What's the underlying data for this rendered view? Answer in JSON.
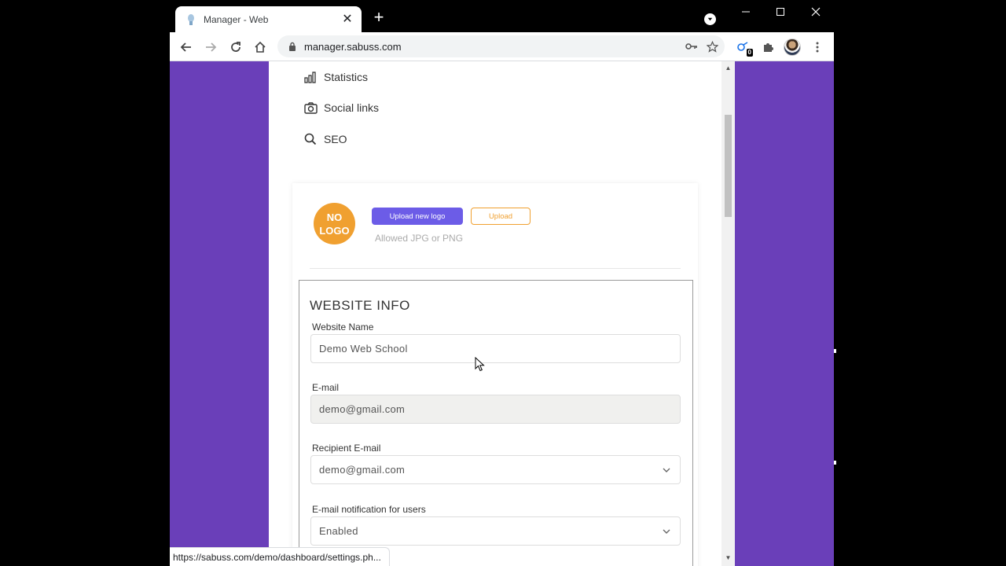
{
  "tab": {
    "title": "Manager - Web",
    "close_label": "✕",
    "new_tab_label": "+"
  },
  "address_bar": {
    "url": "manager.sabuss.com"
  },
  "extensions": {
    "badge_count": "0"
  },
  "sidebar_menu": {
    "items": [
      {
        "label": "Statistics",
        "icon": "bar-chart-icon"
      },
      {
        "label": "Social links",
        "icon": "camera-icon"
      },
      {
        "label": "SEO",
        "icon": "search-icon"
      }
    ]
  },
  "logo_section": {
    "placeholder_line1": "NO",
    "placeholder_line2": "LOGO",
    "upload_new_label": "Upload new logo",
    "upload_label": "Upload",
    "allowed_text": "Allowed JPG or PNG"
  },
  "website_info": {
    "title": "WEBSITE INFO",
    "fields": [
      {
        "label": "Website Name",
        "value": "Demo Web School"
      },
      {
        "label": "E-mail",
        "value": "demo@gmail.com"
      },
      {
        "label": "Recipient E-mail",
        "value": "demo@gmail.com"
      },
      {
        "label": "E-mail notification for users",
        "value": "Enabled"
      }
    ]
  },
  "status_bar": {
    "url": "https://sabuss.com/demo/dashboard/settings.ph..."
  },
  "colors": {
    "page_background": "#6a3fb9",
    "primary_button": "#6c5ce7",
    "accent_orange": "#f0a030"
  }
}
